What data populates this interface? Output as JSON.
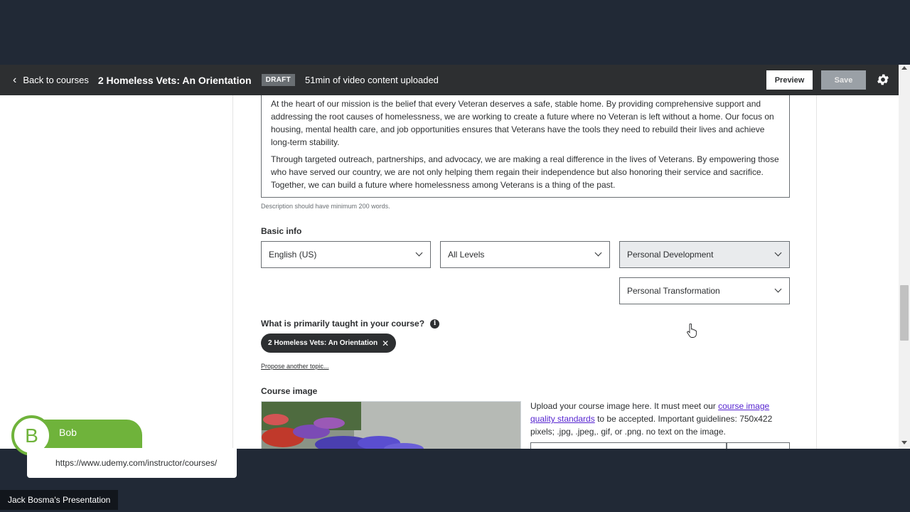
{
  "header": {
    "back_label": "Back to courses",
    "course_title": "2 Homeless Vets: An Orientation",
    "status_badge": "DRAFT",
    "upload_status": "51min of video content uploaded",
    "preview_label": "Preview",
    "save_label": "Save"
  },
  "description": {
    "paragraphs": [
      "At the heart of our mission is the belief that every Veteran deserves a safe, stable home. By providing comprehensive support and addressing the root causes of homelessness, we are working to create a future where no Veteran is left without a home. Our focus on housing, mental health care, and job opportunities ensures that Veterans have the tools they need to rebuild their lives and achieve long-term stability.",
      "Through targeted outreach, partnerships, and advocacy, we are making a real difference in the lives of Veterans. By empowering those who have served our country, we are not only helping them regain their independence but also honoring their service and sacrifice. Together, we can build a future where homelessness among Veterans is a thing of the past."
    ],
    "hint": "Description should have minimum 200 words."
  },
  "basic_info": {
    "label": "Basic info",
    "language": "English (US)",
    "level": "All Levels",
    "category": "Personal Development",
    "subcategory": "Personal Transformation"
  },
  "topic": {
    "label": "What is primarily taught in your course?",
    "info_glyph": "i",
    "selected": "2 Homeless Vets: An Orientation",
    "remove_glyph": "✕",
    "propose_link": "Propose another topic..."
  },
  "course_image": {
    "label": "Course image",
    "upload_text_before": "Upload your course image here. It must meet our ",
    "link_text": "course image quality standards",
    "upload_text_after": " to be accepted. Important guidelines: 750x422 pixels; .jpg, .jpeg,. gif, or .png. no text on the image."
  },
  "presenter": {
    "initial": "B",
    "name": "Bob",
    "url": "https://www.udemy.com/instructor/courses/",
    "presentation_label": "Jack Bosma's Presentation"
  },
  "colors": {
    "header_bg": "#2d2f31",
    "accent_link": "#5624d0",
    "presenter_green": "#6fb33b"
  }
}
